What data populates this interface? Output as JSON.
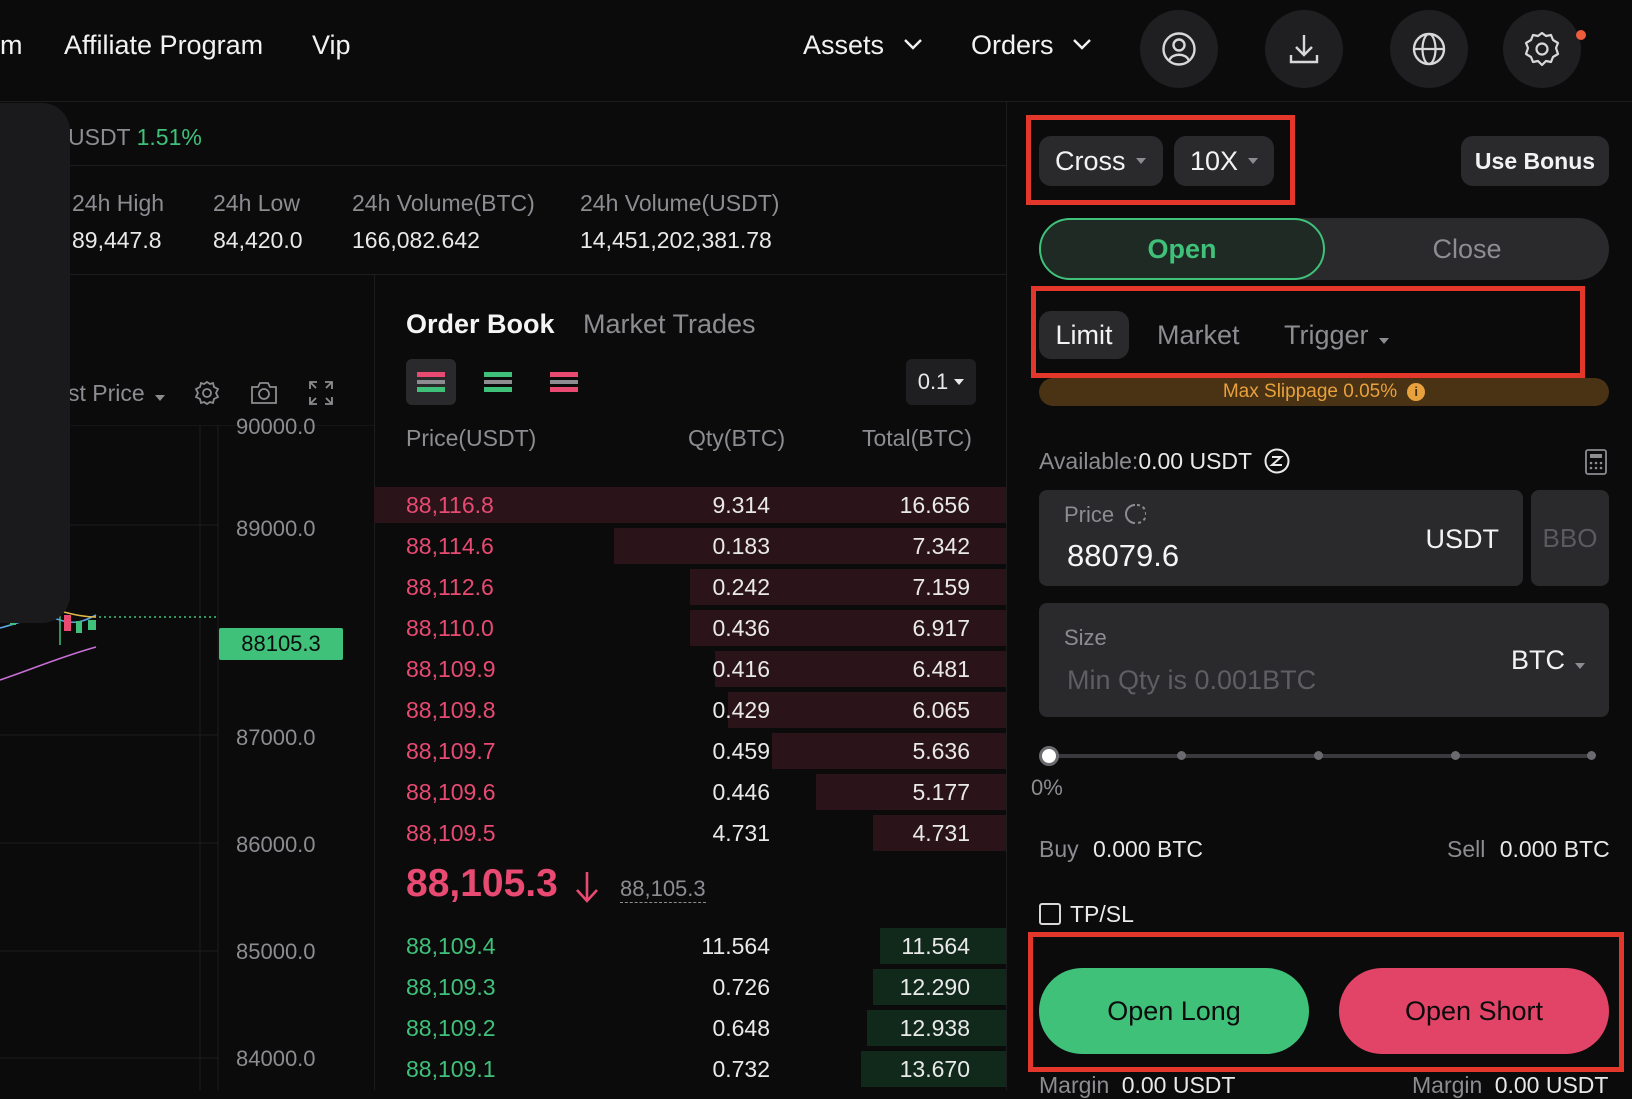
{
  "nav": {
    "partial": "m",
    "affiliate": "Affiliate Program",
    "vip": "Vip",
    "assets": "Assets",
    "orders": "Orders",
    "icons": [
      "user-icon",
      "download-icon",
      "globe-icon",
      "gear-icon"
    ]
  },
  "ticker": {
    "pair_partial": "USDT",
    "change": "1.51%",
    "stats": [
      {
        "label": "24h High",
        "value": "89,447.8"
      },
      {
        "label": "24h Low",
        "value": "84,420.0"
      },
      {
        "label": "24h Volume(BTC)",
        "value": "166,082.642"
      },
      {
        "label": "24h Volume(USDT)",
        "value": "14,451,202,381.78"
      }
    ]
  },
  "chart": {
    "price_mode": "st Price",
    "y_ticks": [
      "90000.0",
      "89000.0",
      "87000.0",
      "86000.0",
      "85000.0",
      "84000.0"
    ],
    "last_price_tag": "88105.3"
  },
  "orderbook": {
    "tab_active": "Order Book",
    "tab_other": "Market Trades",
    "precision": "0.1",
    "headers": {
      "price": "Price(USDT)",
      "qty": "Qty(BTC)",
      "total": "Total(BTC)"
    },
    "asks": [
      {
        "price": "88,116.8",
        "qty": "9.314",
        "total": "16.656",
        "depth": 1.0
      },
      {
        "price": "88,114.6",
        "qty": "0.183",
        "total": "7.342",
        "depth": 0.62
      },
      {
        "price": "88,112.6",
        "qty": "0.242",
        "total": "7.159",
        "depth": 0.5
      },
      {
        "price": "88,110.0",
        "qty": "0.436",
        "total": "6.917",
        "depth": 0.5
      },
      {
        "price": "88,109.9",
        "qty": "0.416",
        "total": "6.481",
        "depth": 0.46
      },
      {
        "price": "88,109.8",
        "qty": "0.429",
        "total": "6.065",
        "depth": 0.44
      },
      {
        "price": "88,109.7",
        "qty": "0.459",
        "total": "5.636",
        "depth": 0.37
      },
      {
        "price": "88,109.6",
        "qty": "0.446",
        "total": "5.177",
        "depth": 0.3
      },
      {
        "price": "88,109.5",
        "qty": "4.731",
        "total": "4.731",
        "depth": 0.21
      }
    ],
    "last_price": "88,105.3",
    "mark_price": "88,105.3",
    "bids": [
      {
        "price": "88,109.4",
        "qty": "11.564",
        "total": "11.564",
        "depth": 0.2
      },
      {
        "price": "88,109.3",
        "qty": "0.726",
        "total": "12.290",
        "depth": 0.21
      },
      {
        "price": "88,109.2",
        "qty": "0.648",
        "total": "12.938",
        "depth": 0.22
      },
      {
        "price": "88,109.1",
        "qty": "0.732",
        "total": "13.670",
        "depth": 0.23
      }
    ]
  },
  "trade": {
    "margin_mode": "Cross",
    "leverage": "10X",
    "use_bonus": "Use Bonus",
    "open": "Open",
    "close": "Close",
    "order_types": {
      "limit": "Limit",
      "market": "Market",
      "trigger": "Trigger"
    },
    "max_slippage": "Max Slippage 0.05%",
    "available_label": "Available:",
    "available_value": "0.00 USDT",
    "price_label": "Price",
    "price_value": "88079.6",
    "price_unit": "USDT",
    "bbo": "BBO",
    "size_label": "Size",
    "size_placeholder": "Min Qty is 0.001BTC",
    "size_unit": "BTC",
    "slider_value": "0%",
    "buy_label": "Buy",
    "buy_value": "0.000 BTC",
    "sell_label": "Sell",
    "sell_value": "0.000 BTC",
    "tpsl": "TP/SL",
    "open_long": "Open Long",
    "open_short": "Open Short",
    "margin_left_label": "Margin",
    "margin_left_value": "0.00 USDT",
    "margin_right_label": "Margin",
    "margin_right_value": "0.00 USDT"
  }
}
